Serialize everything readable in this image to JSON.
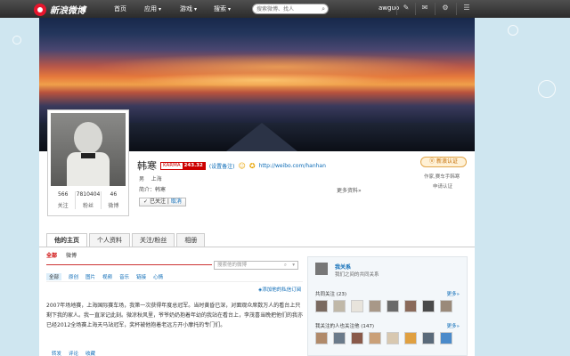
{
  "topbar": {
    "logo": "新浪微博",
    "nav": [
      {
        "label": "首页",
        "dropdown": false
      },
      {
        "label": "应用",
        "dropdown": true
      },
      {
        "label": "游戏",
        "dropdown": true
      },
      {
        "label": "搜索",
        "dropdown": true
      }
    ],
    "search_placeholder": "搜索微博、找人",
    "user": "awguo",
    "icons": [
      "edit-icon",
      "mail-icon",
      "gear-icon",
      "menu-icon"
    ]
  },
  "profile": {
    "name": "韩寒",
    "karma_label": "KARMA",
    "karma_value": "243.32",
    "set_remark": "(设置备注)",
    "url": "http://weibo.com/hanhan",
    "gender": "男",
    "location": "上海",
    "bio_label": "简介：",
    "bio": "韩寒",
    "more_info": "更多资料»",
    "followed": "已关注",
    "unfollow": "取消",
    "stats": [
      {
        "value": "566",
        "label": "关注"
      },
      {
        "value": "7810404",
        "label": "粉丝"
      },
      {
        "value": "46",
        "label": "微博"
      }
    ],
    "verify_badge": "新浪认证",
    "verify_desc": "作家,赛车手韩寒",
    "apply_verify": "申请认证"
  },
  "tabs": [
    "他的主页",
    "个人资料",
    "关注/粉丝",
    "相册"
  ],
  "feed": {
    "subtabs": [
      "全部",
      "微博"
    ],
    "search_placeholder": "搜索他的微博",
    "filters": [
      "全部",
      "原创",
      "图片",
      "视频",
      "音乐",
      "链接",
      "心情"
    ],
    "subscribe": "添加他的私信订阅",
    "post_text": "2007年场地赛，上海国际赛车场，我第一次获得年度总冠军。当时黄昏已深，对面观众席数万人的看台上只剩下我的家人。我一直深记此刻。微凉秋风里，爷爷奶奶抱着年幼的我站在看台上，李茂喜当晚把他们的我亦已经2012全场赛上海天马站冠军，奖杯被他抱着老远方开小摩托的专门们。",
    "actions": [
      "转发",
      "评论",
      "收藏"
    ]
  },
  "sidebar": {
    "me_name": "我关系",
    "me_relation": "我们之间的共同关系",
    "common_follow": "共同关注 (23)",
    "common_fans": "我关注的人也关注他 (147)",
    "more": "更多»"
  }
}
